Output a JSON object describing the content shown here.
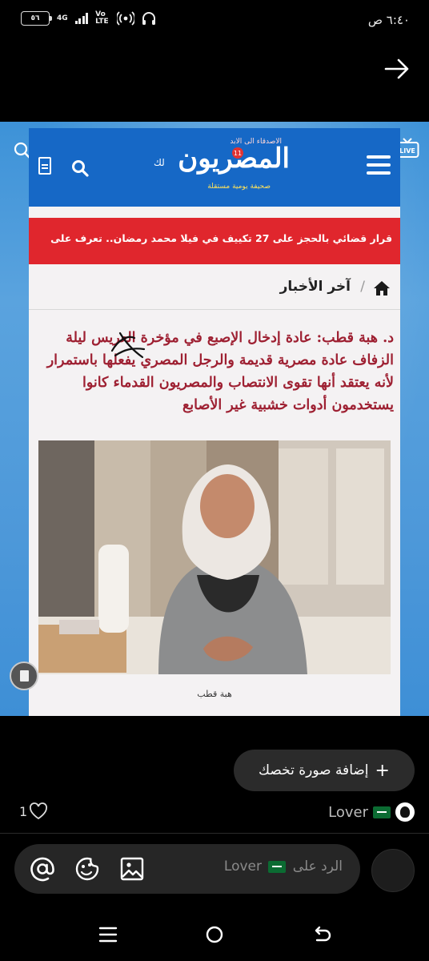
{
  "status_bar": {
    "time": "٦:٤٠ ص",
    "battery": "٥٦",
    "network": "4G",
    "volte": "Vo LTE"
  },
  "photo": {
    "site": {
      "logo_main": "المصريون",
      "logo_top": "الاصدقاء الى الابد",
      "logo_badge": "11",
      "logo_sub": "صحيفة يومية مستقلة",
      "logo_tail": "لك",
      "ticker": "قرار قضائي بالحجز على 27 تكييف في فيلا محمد رمضان.. تعرف على",
      "breadcrumb": "آخر الأخبار",
      "breadcrumb_sep": "/",
      "headline": "د. هبة قطب: عادة إدخال الإصبع في مؤخرة العريس ليلة الزفاف عادة مصرية قديمة والرجل المصري يفعلها باستمرار لأنه يعتقد أنها تقوى الانتصاب والمصريون القدماء كانوا يستخدمون أدوات خشبية غير الأصابع",
      "caption": "هبة قطب"
    }
  },
  "add_photo": {
    "label": "إضافة صورة تخصك",
    "icon": "+"
  },
  "likes": {
    "count": "1",
    "icon": "heart-icon"
  },
  "post_user": {
    "name": "Lover"
  },
  "reply": {
    "placeholder_prefix": "الرد على",
    "placeholder_user": "Lover"
  },
  "colors": {
    "site_blue": "#1668c6",
    "ticker_red": "#e0262d",
    "headline_red": "#9e2032",
    "background_blue": "#4d98d9"
  }
}
